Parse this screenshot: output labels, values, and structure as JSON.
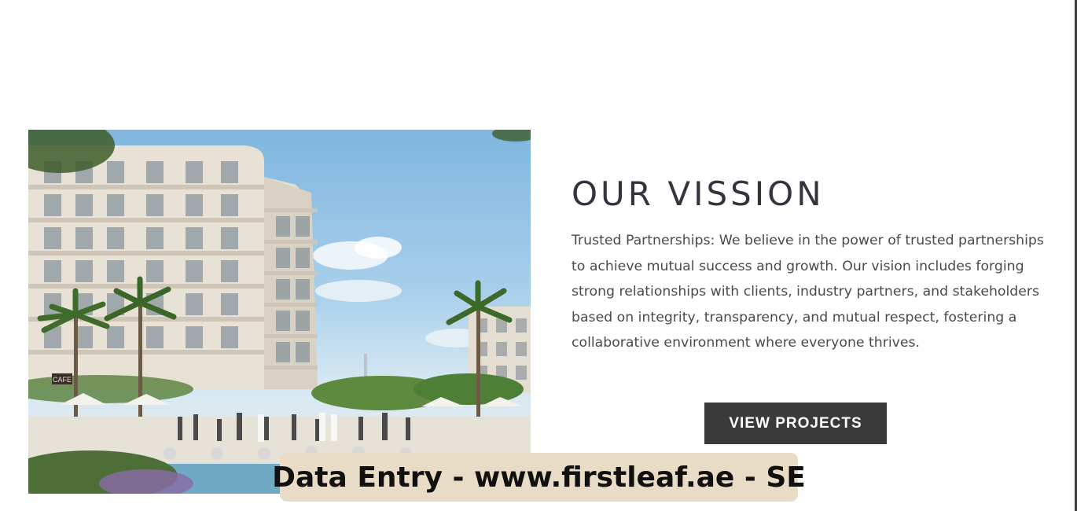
{
  "vision": {
    "title": "OUR VISSION",
    "body": "Trusted Partnerships: We believe in the power of trusted partnerships to achieve mutual success and growth. Our vision includes forging strong relationships with clients, industry partners, and stakeholders based on integrity, transparency, and mutual respect, fostering a collaborative environment where everyone thrives.",
    "button_label": "VIEW PROJECTS"
  },
  "image": {
    "description_icon": "residential-building-photo",
    "sign_text": "CAFE"
  },
  "watermark": {
    "text": "Data Entry - www.firstleaf.ae - SE"
  },
  "colors": {
    "button_bg": "#3a3a3a",
    "title_color": "#34343f",
    "watermark_bg": "#e9dcc7"
  }
}
